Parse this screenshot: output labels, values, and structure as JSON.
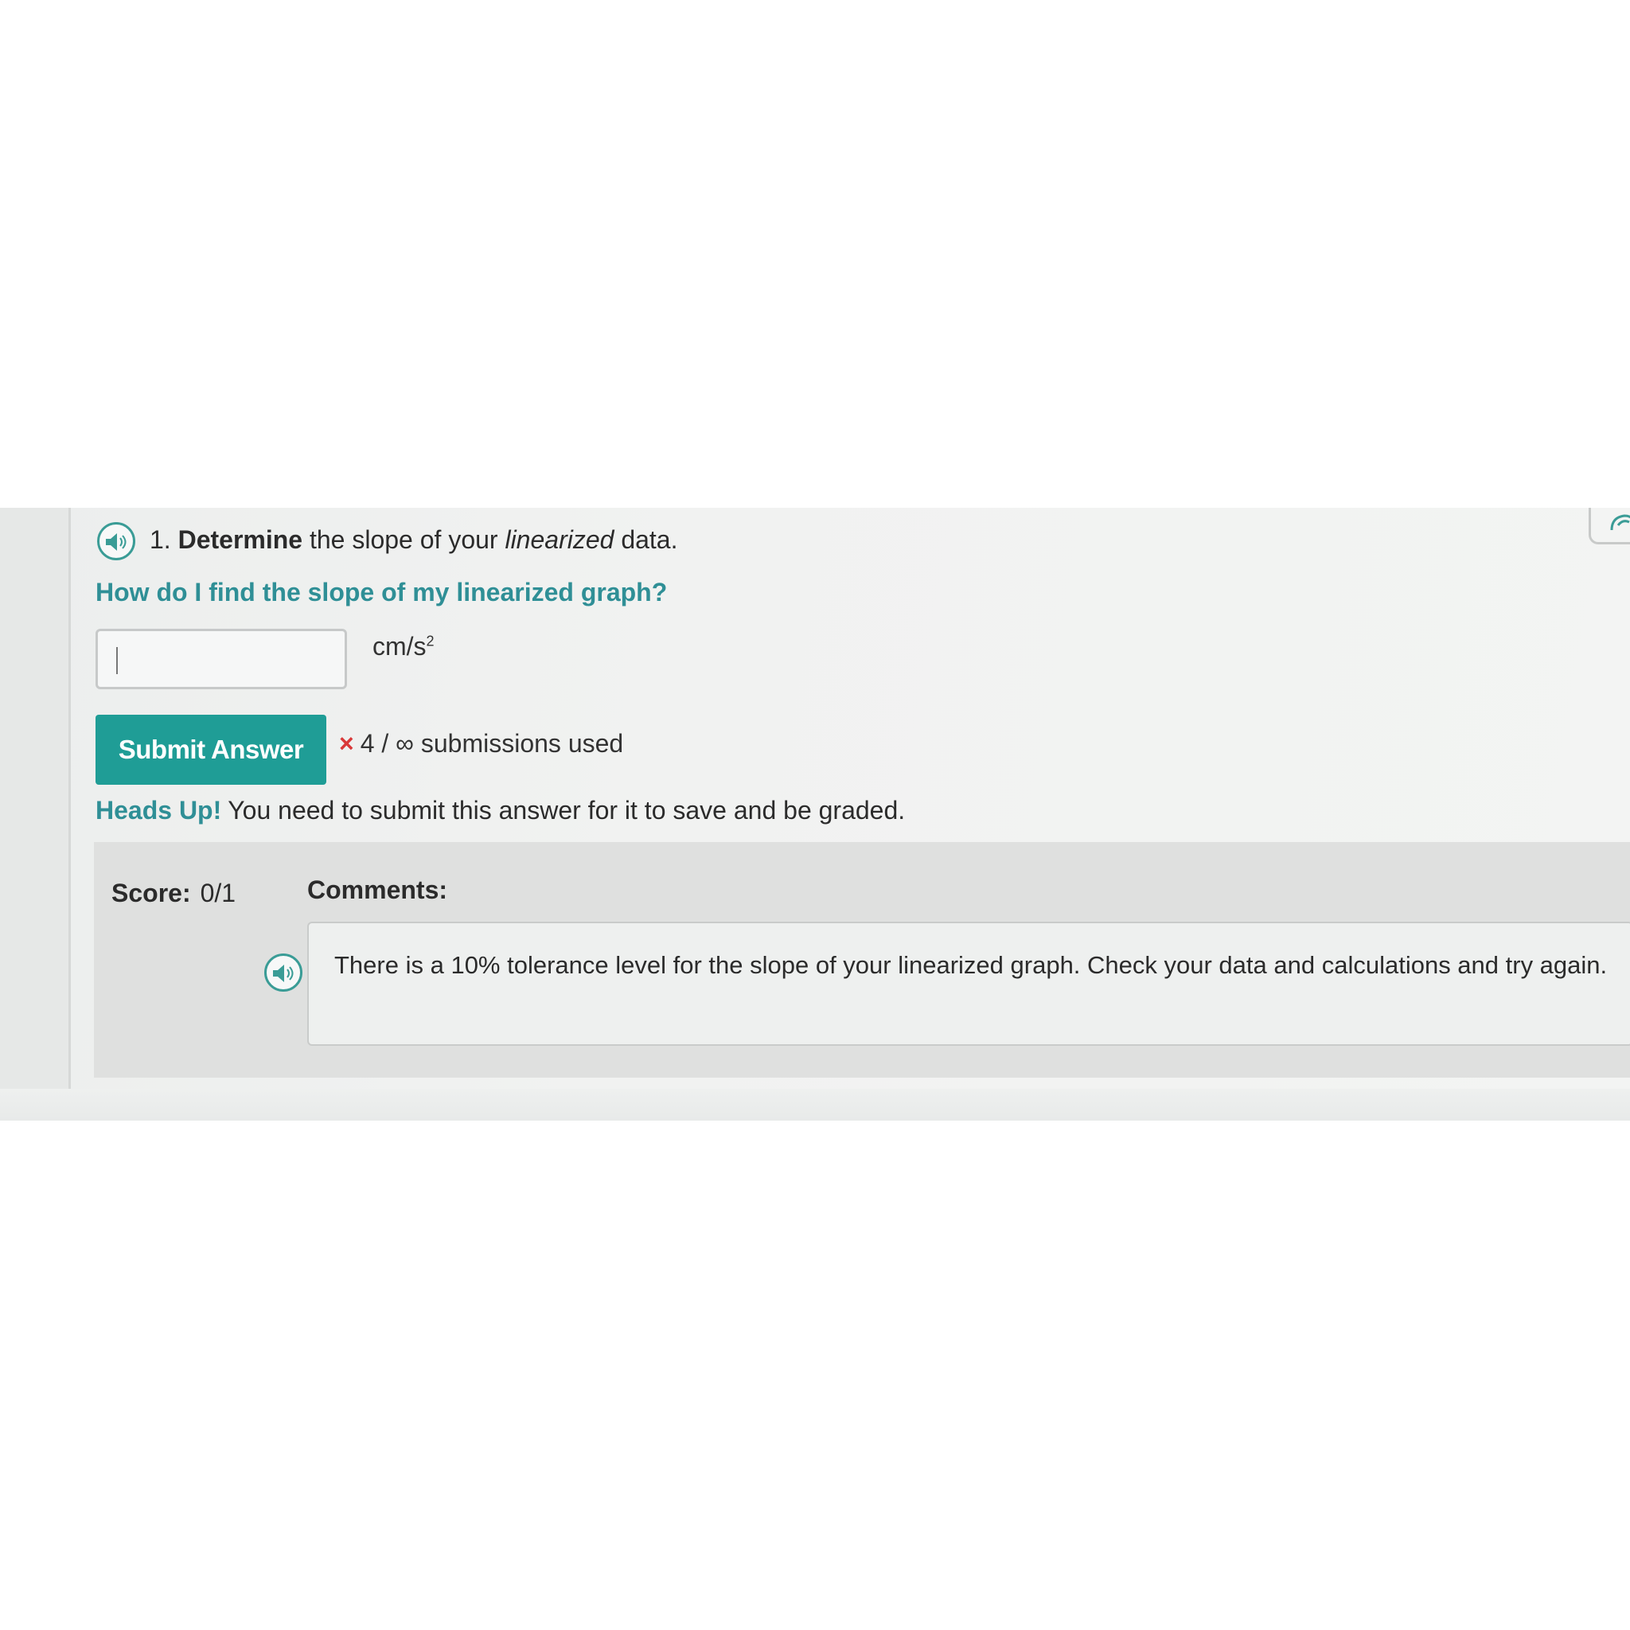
{
  "question": {
    "number": "1.",
    "verb": "Determine",
    "text_before": "the slope of your",
    "emphasis": "linearized",
    "text_after": "data."
  },
  "help_link": "How do I find the slope of my linearized graph?",
  "answer": {
    "value": "",
    "units_base": "cm/s",
    "units_exp": "2"
  },
  "submit": {
    "label": "Submit Answer",
    "status_mark": "×",
    "status_text": "4 / ∞ submissions used"
  },
  "notice": {
    "lead": "Heads Up!",
    "text": "You need to submit this answer for it to save and be graded."
  },
  "score": {
    "label": "Score:",
    "value": "0/1"
  },
  "comments": {
    "label": "Comments:",
    "text": "There is a 10% tolerance level for the slope of your linearized graph. Check your data and calculations and try again."
  },
  "icons": {
    "question_audio": "speaker-icon",
    "comment_audio": "speaker-icon",
    "edit": "edit-icon"
  },
  "colors": {
    "accent": "#1f9d96",
    "link": "#2f8f96",
    "error": "#d93838",
    "panel": "#dfe0df"
  }
}
